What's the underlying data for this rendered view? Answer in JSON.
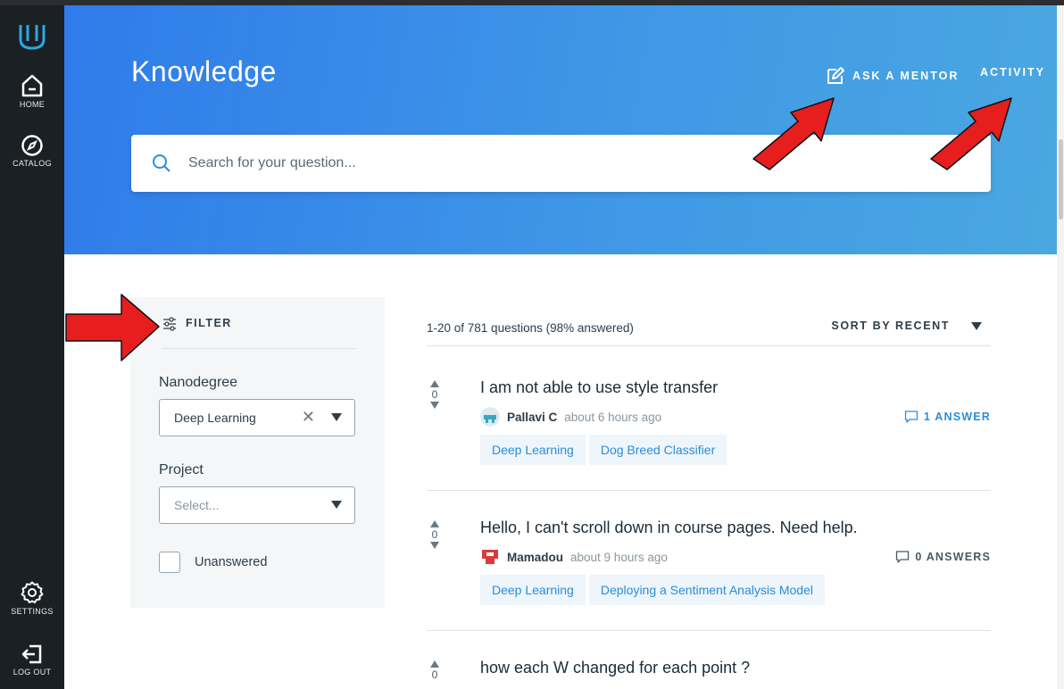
{
  "sidebar": {
    "items": [
      {
        "label": "HOME",
        "icon": "home-icon"
      },
      {
        "label": "CATALOG",
        "icon": "compass-icon"
      },
      {
        "label": "SETTINGS",
        "icon": "gear-icon"
      },
      {
        "label": "LOG OUT",
        "icon": "logout-icon"
      }
    ]
  },
  "header": {
    "title": "Knowledge",
    "ask_mentor": "ASK A MENTOR",
    "activity": "ACTIVITY"
  },
  "search": {
    "placeholder": "Search for your question..."
  },
  "filter": {
    "heading": "FILTER",
    "nanodegree_label": "Nanodegree",
    "nanodegree_value": "Deep Learning",
    "project_label": "Project",
    "project_placeholder": "Select...",
    "unanswered_label": "Unanswered"
  },
  "list": {
    "count_text": "1-20 of 781 questions (98% answered)",
    "sort_label": "SORT BY RECENT",
    "questions": [
      {
        "title": "I am not able to use style transfer",
        "votes": "0",
        "author": "Pallavi C",
        "time": "about 6 hours ago",
        "answers": "1 ANSWER",
        "tags": [
          "Deep Learning",
          "Dog Breed Classifier"
        ]
      },
      {
        "title": "Hello, I can't scroll down in course pages. Need help.",
        "votes": "0",
        "author": "Mamadou",
        "time": "about 9 hours ago",
        "answers": "0 ANSWERS",
        "tags": [
          "Deep Learning",
          "Deploying a Sentiment Analysis Model"
        ]
      },
      {
        "title": "how each W changed for each point ?",
        "votes": "0"
      }
    ]
  },
  "colors": {
    "accent": "#2b8ed8",
    "sidebar": "#1b2024",
    "arrow": "#e61e1e"
  }
}
